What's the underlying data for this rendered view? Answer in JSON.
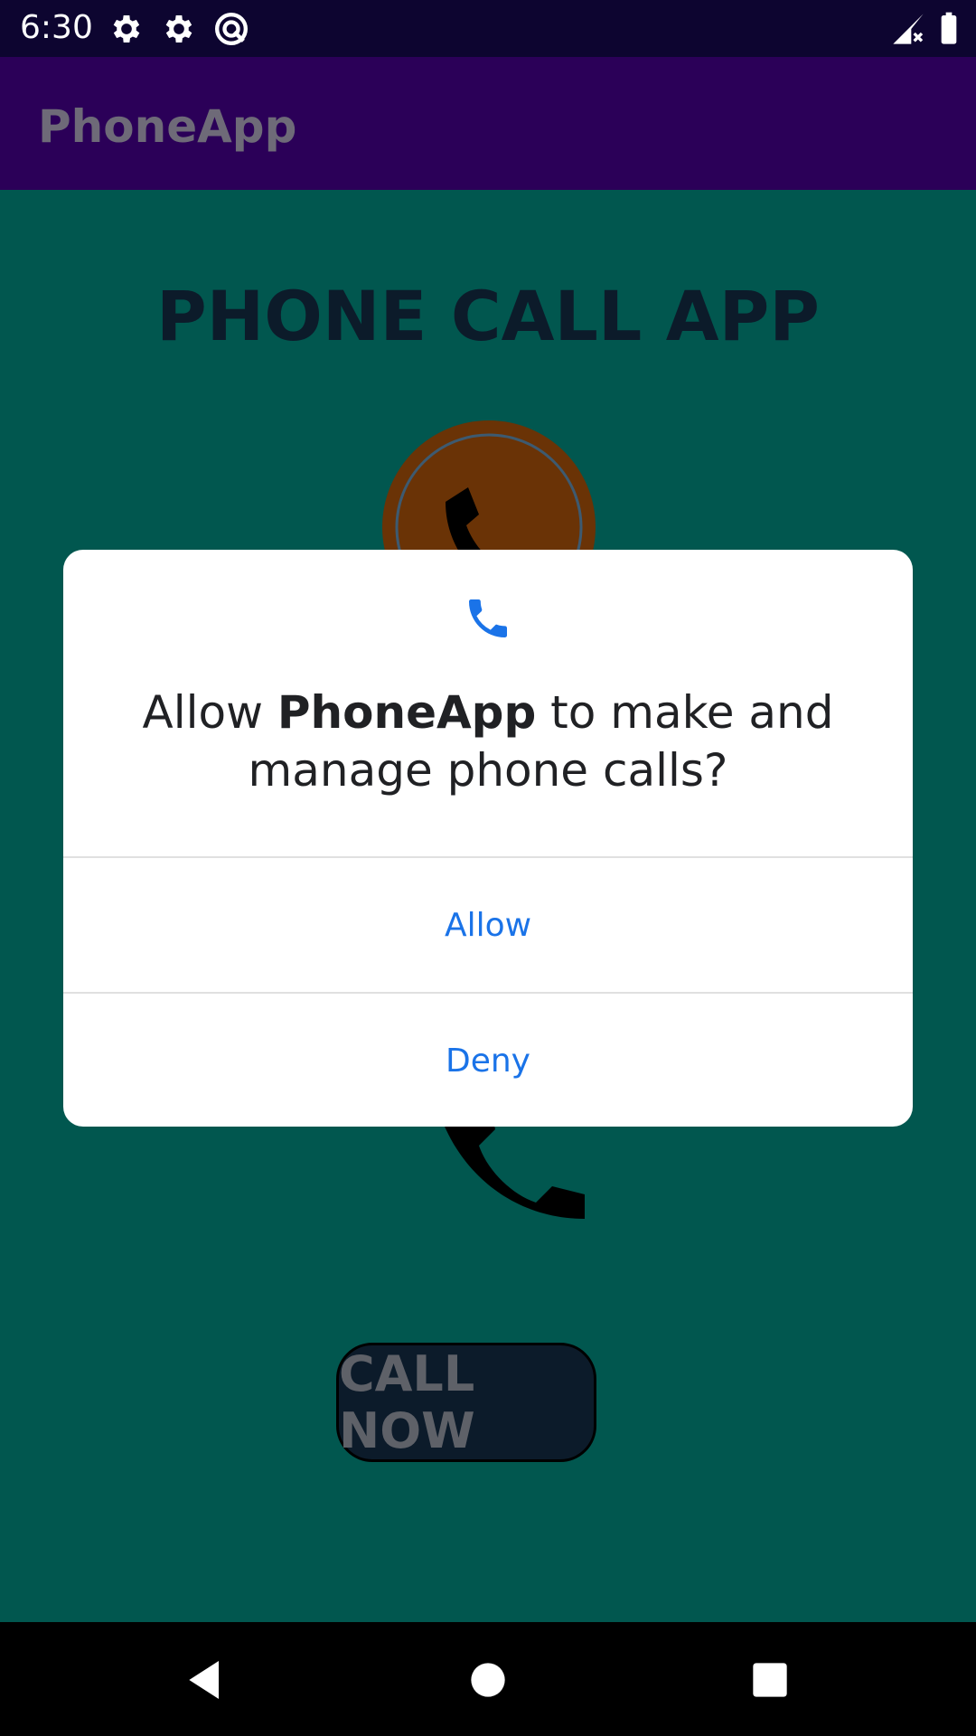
{
  "status_bar": {
    "time": "6:30",
    "icons": [
      "settings-icon",
      "settings-icon",
      "vpn-icon",
      "signal-icon",
      "battery-icon"
    ]
  },
  "app_bar": {
    "title": "PhoneApp"
  },
  "main": {
    "heading": "PHONE CALL APP",
    "call_button_label": "CALL NOW",
    "icons": [
      "phone-circle-icon",
      "phone-icon"
    ]
  },
  "dialog": {
    "icon": "phone-icon",
    "message_prefix": "Allow ",
    "app_name": "PhoneApp",
    "message_line1_suffix": " to make and",
    "message_line2": "manage phone calls?",
    "allow_label": "Allow",
    "deny_label": "Deny",
    "accent_color": "#1a73e8"
  },
  "nav_bar": {
    "icons": [
      "back-icon",
      "home-icon",
      "recents-icon"
    ]
  },
  "colors": {
    "status_bar": "#0d0530",
    "app_bar": "#2b0058",
    "background": "#01574f",
    "button": "#0c1b2a"
  }
}
